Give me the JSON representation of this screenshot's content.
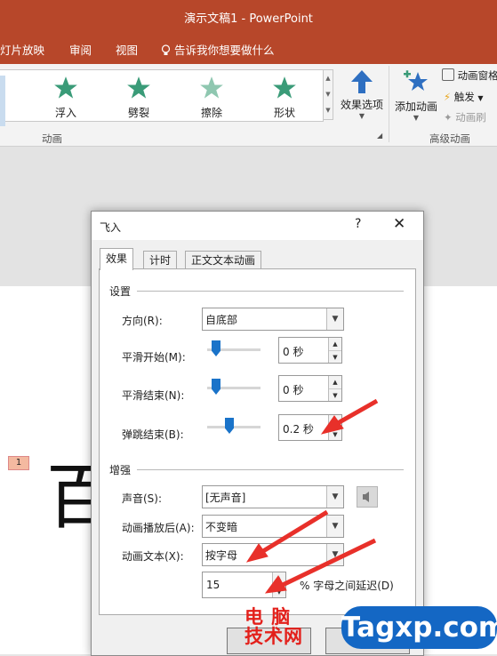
{
  "window": {
    "title": "演示文稿1  -  PowerPoint",
    "accent": "#b7472a"
  },
  "menu": {
    "items": [
      "灯片放映",
      "审阅",
      "视图"
    ],
    "tell_me": "告诉我你想要做什么"
  },
  "ribbon": {
    "animations": [
      "浮入",
      "劈裂",
      "擦除",
      "形状"
    ],
    "effect_options": "效果选项",
    "add_animation": "添加动画",
    "pane": "动画窗格",
    "trigger": "触发",
    "painter": "动画刷",
    "group_animation": "动画",
    "group_advanced": "高级动画"
  },
  "slide": {
    "anim_tag": "1",
    "big_char": "百"
  },
  "dialog": {
    "title": "飞入",
    "help": "?",
    "close": "✕",
    "tabs": [
      "效果",
      "计时",
      "正文文本动画"
    ],
    "settings_header": "设置",
    "direction_label": "方向(R):",
    "direction_value": "自底部",
    "smooth_start_label": "平滑开始(M):",
    "smooth_start_value": "0 秒",
    "smooth_start_level": 0.1,
    "smooth_end_label": "平滑结束(N):",
    "smooth_end_value": "0 秒",
    "smooth_end_level": 0.1,
    "bounce_end_label": "弹跳结束(B):",
    "bounce_end_value": "0.2 秒",
    "bounce_end_level": 0.4,
    "enhance_header": "增强",
    "sound_label": "声音(S):",
    "sound_value": "[无声音]",
    "after_label": "动画播放后(A):",
    "after_value": "不变暗",
    "text_label": "动画文本(X):",
    "text_value": "按字母",
    "delay_value": "15",
    "delay_suffix": "% 字母之间延迟(D)"
  },
  "watermark": {
    "cn_line1": "电 脑",
    "cn_line2": "技术网",
    "site": "Tagxp.com"
  },
  "colors": {
    "arrow": "#e8302a",
    "slider": "#1a73c9",
    "star": "#3a9b78"
  }
}
